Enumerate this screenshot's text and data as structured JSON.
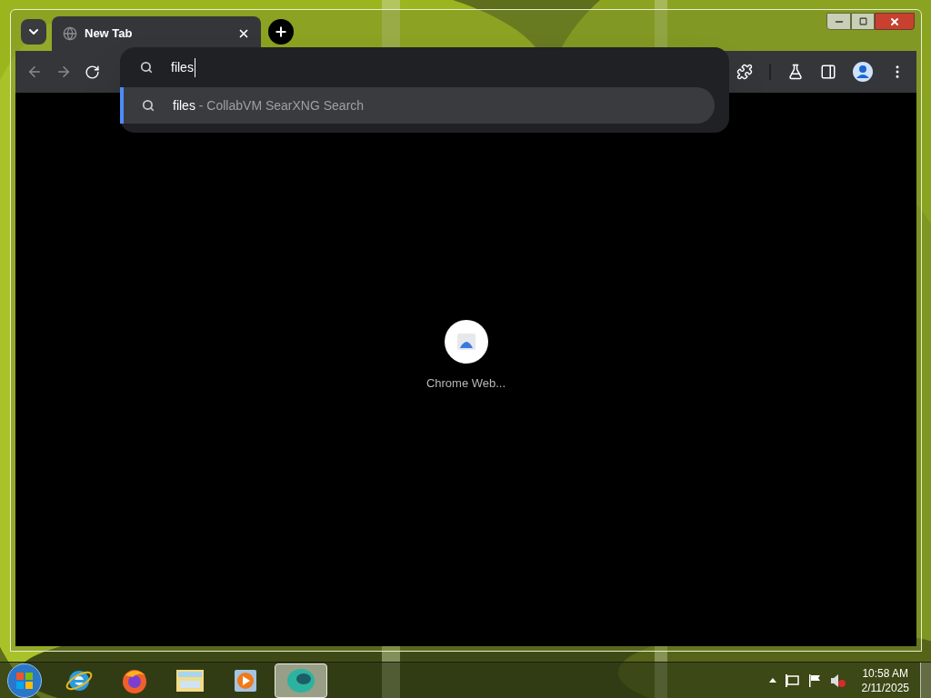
{
  "tab": {
    "title": "New Tab",
    "selected": true
  },
  "omnibox": {
    "value": "files",
    "suggestions": [
      {
        "query": "files",
        "source": "- CollabVM SearXNG Search",
        "selected": true
      }
    ]
  },
  "shortcut": {
    "label": "Chrome Web..."
  },
  "taskbar": {
    "apps": [
      {
        "kind": "ie",
        "selected": false
      },
      {
        "kind": "firefox",
        "selected": false
      },
      {
        "kind": "explorer",
        "selected": false
      },
      {
        "kind": "media",
        "selected": false
      },
      {
        "kind": "vm",
        "selected": true
      }
    ],
    "volume": {
      "muted": true
    },
    "clock": {
      "time": "10:58 AM",
      "date": "2/11/2025"
    }
  }
}
